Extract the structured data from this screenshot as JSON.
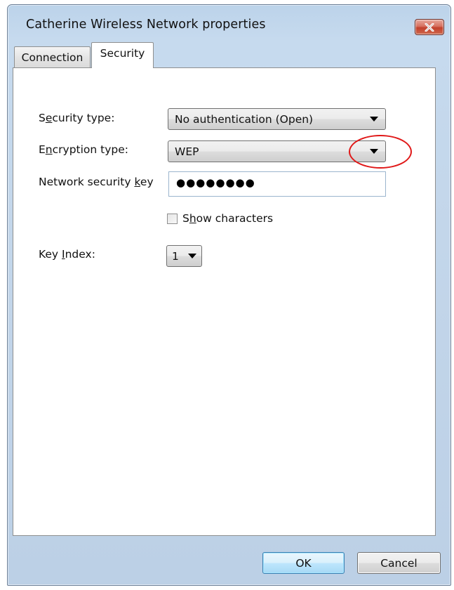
{
  "window": {
    "title": "Catherine  Wireless Network properties",
    "close_icon": "close-icon"
  },
  "tabs": [
    {
      "label": "Connection",
      "selected": false
    },
    {
      "label": "Security",
      "selected": true
    }
  ],
  "security": {
    "security_type_label_pre": "S",
    "security_type_label_ul": "e",
    "security_type_label_post": "curity type:",
    "security_type_value": "No authentication (Open)",
    "encryption_type_label_pre": "E",
    "encryption_type_label_ul": "n",
    "encryption_type_label_post": "cryption type:",
    "encryption_type_value": "WEP",
    "network_key_label_pre": "Network security ",
    "network_key_label_ul": "k",
    "network_key_label_post": "ey",
    "network_key_value": "●●●●●●●●",
    "show_characters_ul": "h",
    "show_characters_pre": "S",
    "show_characters_post": "ow characters",
    "show_characters_checked": false,
    "key_index_label_pre": "Key ",
    "key_index_label_ul": "I",
    "key_index_label_post": "ndex:",
    "key_index_value": "1"
  },
  "buttons": {
    "ok": "OK",
    "cancel": "Cancel"
  },
  "colors": {
    "highlight_ring": "#e01818",
    "close_button": "#c2402c",
    "ok_button_border": "#3c7fb1"
  }
}
